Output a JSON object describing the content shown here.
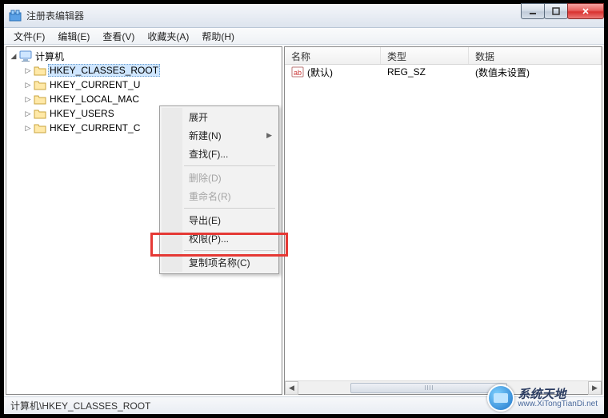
{
  "window": {
    "title": "注册表编辑器"
  },
  "menubar": {
    "items": [
      {
        "label": "文件(F)"
      },
      {
        "label": "编辑(E)"
      },
      {
        "label": "查看(V)"
      },
      {
        "label": "收藏夹(A)"
      },
      {
        "label": "帮助(H)"
      }
    ]
  },
  "tree": {
    "root": {
      "label": "计算机"
    },
    "nodes": [
      {
        "label": "HKEY_CLASSES_ROOT",
        "selected": true
      },
      {
        "label": "HKEY_CURRENT_U"
      },
      {
        "label": "HKEY_LOCAL_MAC"
      },
      {
        "label": "HKEY_USERS"
      },
      {
        "label": "HKEY_CURRENT_C"
      }
    ]
  },
  "list": {
    "headers": {
      "name": "名称",
      "type": "类型",
      "data": "数据"
    },
    "rows": [
      {
        "name": "(默认)",
        "type": "REG_SZ",
        "data": "(数值未设置)"
      }
    ]
  },
  "context_menu": {
    "items": [
      {
        "label": "展开",
        "kind": "item"
      },
      {
        "label": "新建(N)",
        "kind": "submenu"
      },
      {
        "label": "查找(F)...",
        "kind": "item"
      },
      {
        "kind": "sep"
      },
      {
        "label": "删除(D)",
        "kind": "item",
        "disabled": true
      },
      {
        "label": "重命名(R)",
        "kind": "item",
        "disabled": true
      },
      {
        "kind": "sep"
      },
      {
        "label": "导出(E)",
        "kind": "item"
      },
      {
        "label": "权限(P)...",
        "kind": "item",
        "highlighted": true
      },
      {
        "kind": "sep"
      },
      {
        "label": "复制项名称(C)",
        "kind": "item"
      }
    ]
  },
  "statusbar": {
    "path": "计算机\\HKEY_CLASSES_ROOT"
  },
  "watermark": {
    "line1": "系统天地",
    "line2": "www.XiTongTianDi.net"
  }
}
